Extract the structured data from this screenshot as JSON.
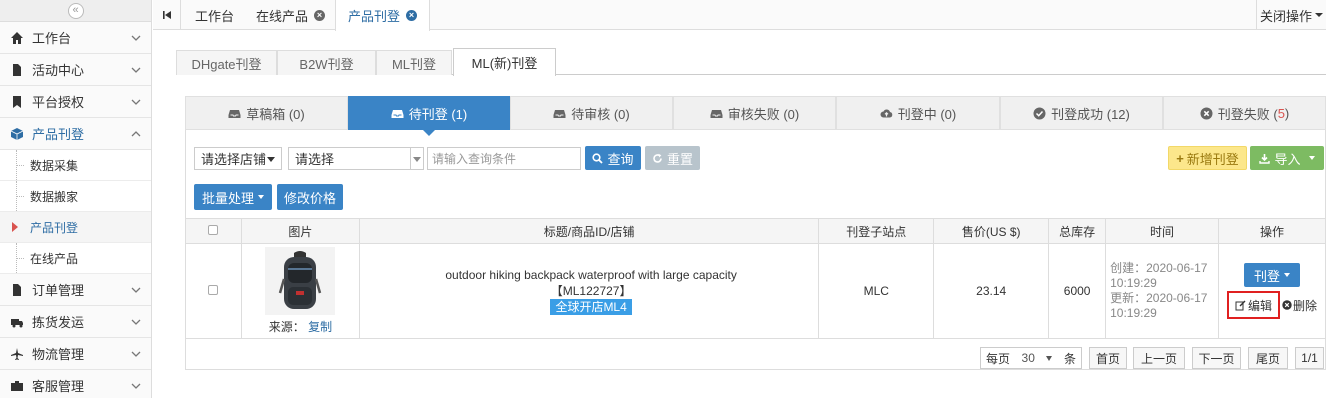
{
  "sidebar": {
    "collapse_icon": "«",
    "items": [
      {
        "label": "工作台",
        "icon": "home-icon"
      },
      {
        "label": "活动中心",
        "icon": "file-icon"
      },
      {
        "label": "平台授权",
        "icon": "bookmark-icon"
      },
      {
        "label": "产品刊登",
        "icon": "cube-icon"
      },
      {
        "label": "订单管理",
        "icon": "file-icon"
      },
      {
        "label": "拣货发运",
        "icon": "truck-icon"
      },
      {
        "label": "物流管理",
        "icon": "plane-icon"
      },
      {
        "label": "客服管理",
        "icon": "briefcase-icon"
      }
    ],
    "sub_items": [
      "数据采集",
      "数据搬家",
      "产品刊登",
      "在线产品"
    ]
  },
  "topbar": {
    "tabs": [
      "工作台",
      "在线产品",
      "产品刊登"
    ],
    "close_ops": "关闭操作"
  },
  "platform_tabs": [
    "DHgate刊登",
    "B2W刊登",
    "ML刊登",
    "ML(新)刊登"
  ],
  "status_tabs": [
    {
      "label": "草稿箱 (0)",
      "icon": "inbox-icon"
    },
    {
      "label": "待刊登 (1)",
      "icon": "inbox-icon"
    },
    {
      "label": "待审核 (0)",
      "icon": "inbox-icon"
    },
    {
      "label": "审核失败 (0)",
      "icon": "inbox-icon"
    },
    {
      "label": "刊登中 (0)",
      "icon": "cloud-upload-icon"
    },
    {
      "label": "刊登成功 (12)",
      "icon": "check-circle-icon"
    },
    {
      "label": "刊登失败 (",
      "count": "5",
      "suffix": ")",
      "icon": "times-circle-icon"
    }
  ],
  "filters": {
    "shop_select": "请选择店铺",
    "type_select": "请选择",
    "query_placeholder": "请输入查询条件",
    "query_button": "查询",
    "reset_button": "重置",
    "add_button": "新增刊登",
    "import_button": "导入",
    "batch_button": "批量处理",
    "modify_price_button": "修改价格"
  },
  "table": {
    "headers": [
      "图片",
      "标题/商品ID/店铺",
      "刊登子站点",
      "售价(US $)",
      "总库存",
      "时间",
      "操作"
    ],
    "rows": [
      {
        "source_label": "来源：",
        "source_link": "复制",
        "title": "outdoor hiking backpack waterproof with large capacity",
        "product_id": "【ML122727】",
        "shop": "全球开店ML4",
        "site": "MLC",
        "price": "23.14",
        "stock": "6000",
        "created": "创建：2020-06-17 10:19:29",
        "updated": "更新：2020-06-17 10:19:29",
        "publish_button": "刊登",
        "edit_label": "编辑",
        "delete_label": "删除"
      }
    ]
  },
  "pagination": {
    "per_page_label": "每页",
    "per_page_value": "30",
    "per_page_unit": "条",
    "first": "首页",
    "prev": "上一页",
    "next": "下一页",
    "last": "尾页",
    "page_info": "1/1"
  }
}
